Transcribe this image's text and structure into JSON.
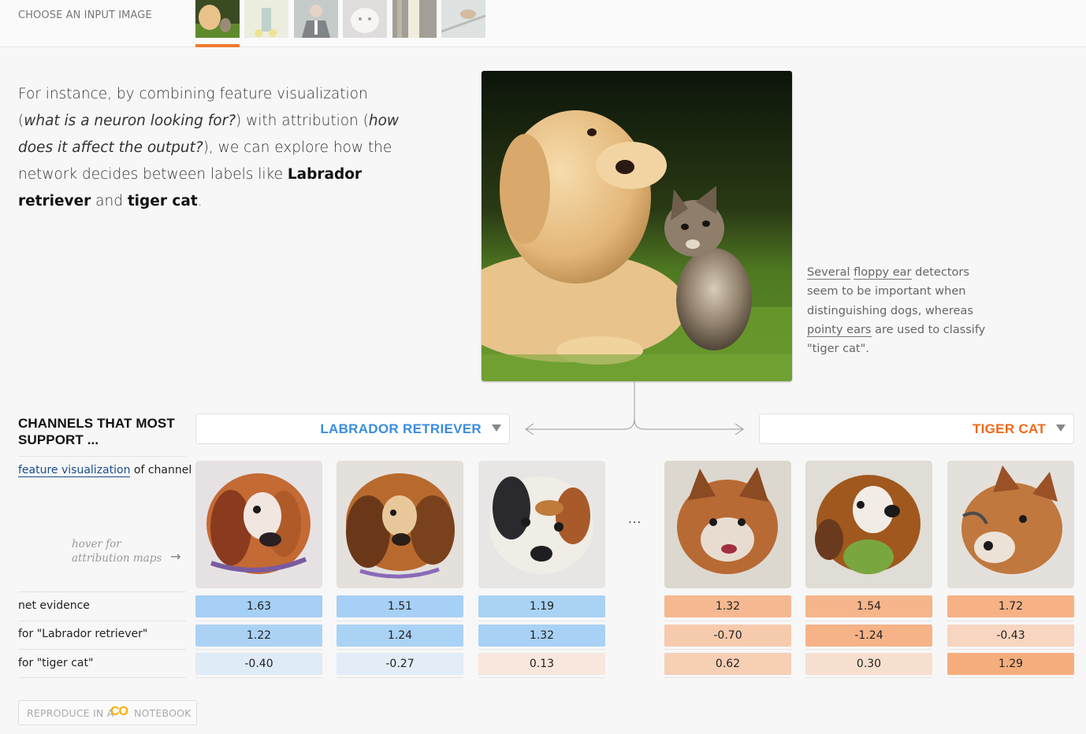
{
  "chooser": {
    "label": "CHOOSE AN INPUT IMAGE",
    "thumbnails": [
      {
        "name": "dog-and-cat",
        "selected": true
      },
      {
        "name": "lemons-vase",
        "selected": false
      },
      {
        "name": "man-in-suit",
        "selected": false
      },
      {
        "name": "white-animal",
        "selected": false
      },
      {
        "name": "glass",
        "selected": false
      },
      {
        "name": "bird",
        "selected": false
      }
    ],
    "selected_color": "#f07a30"
  },
  "intro": {
    "p1": "For instance, by combining feature visualization (",
    "em1": "what is a neuron looking for?",
    "p2": ") with attribution (",
    "em2": "how does it affect the output?",
    "p3": "), we can explore how the network decides between labels like ",
    "b1": "Labrador retriever",
    "p4": " and ",
    "b2": "tiger cat",
    "p5": "."
  },
  "side_note": {
    "s1": "Several",
    "s2": " ",
    "s3": "floppy ear",
    "s4": " detectors seem to be important when distinguishing dogs, whereas ",
    "s5": "pointy ears",
    "s6": " are used to classify \"tiger cat\"."
  },
  "heading": "CHANNELS THAT MOST SUPPORT ...",
  "classes": {
    "left": {
      "label": "LABRADOR RETRIEVER",
      "color": "#3a8de0"
    },
    "right": {
      "label": "TIGER CAT",
      "color": "#ee6a1a"
    }
  },
  "rows": {
    "featvis_link": "feature visualization",
    "featvis_suffix": " of channel",
    "hover_hint": "hover for attribution maps",
    "hover_arrow": "→",
    "net_evidence": "net evidence",
    "for_lab": "for \"Labrador retriever\"",
    "for_tiger": "for \"tiger cat\""
  },
  "ellipsis": "...",
  "channels": [
    {
      "side": "lab",
      "net": "1.63",
      "lab": "1.22",
      "tiger": "-0.40"
    },
    {
      "side": "lab",
      "net": "1.51",
      "lab": "1.24",
      "tiger": "-0.27"
    },
    {
      "side": "lab",
      "net": "1.19",
      "lab": "1.32",
      "tiger": "0.13"
    },
    {
      "side": "tiger",
      "net": "1.32",
      "lab": "-0.70",
      "tiger": "0.62"
    },
    {
      "side": "tiger",
      "net": "1.54",
      "lab": "-1.24",
      "tiger": "0.30"
    },
    {
      "side": "tiger",
      "net": "1.72",
      "lab": "-0.43",
      "tiger": "1.29"
    }
  ],
  "reproduce": {
    "left": "REPRODUCE IN A",
    "logo": "CO",
    "right": "NOTEBOOK"
  }
}
